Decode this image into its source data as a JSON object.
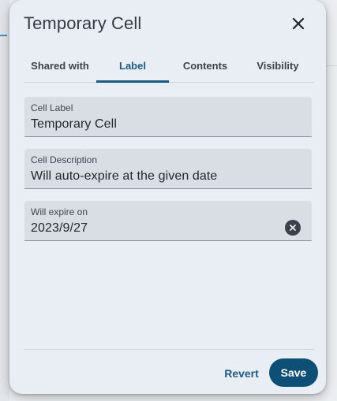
{
  "dialog": {
    "title": "Temporary Cell",
    "close_icon": "close-icon"
  },
  "tabs": [
    {
      "label": "Shared with",
      "active": false
    },
    {
      "label": "Label",
      "active": true
    },
    {
      "label": "Contents",
      "active": false
    },
    {
      "label": "Visibility",
      "active": false
    }
  ],
  "fields": {
    "cell_label": {
      "label": "Cell Label",
      "value": "Temporary Cell"
    },
    "cell_description": {
      "label": "Cell Description",
      "value": "Will auto-expire at the given date"
    },
    "expire": {
      "label": "Will expire on",
      "value": "2023/9/27",
      "clear_icon": "clear-icon"
    }
  },
  "footer": {
    "revert_label": "Revert",
    "save_label": "Save"
  },
  "colors": {
    "accent": "#1e5a80",
    "primary_button": "#0e4f75",
    "dialog_bg": "#e9eef4",
    "field_bg": "#d9dee4"
  }
}
